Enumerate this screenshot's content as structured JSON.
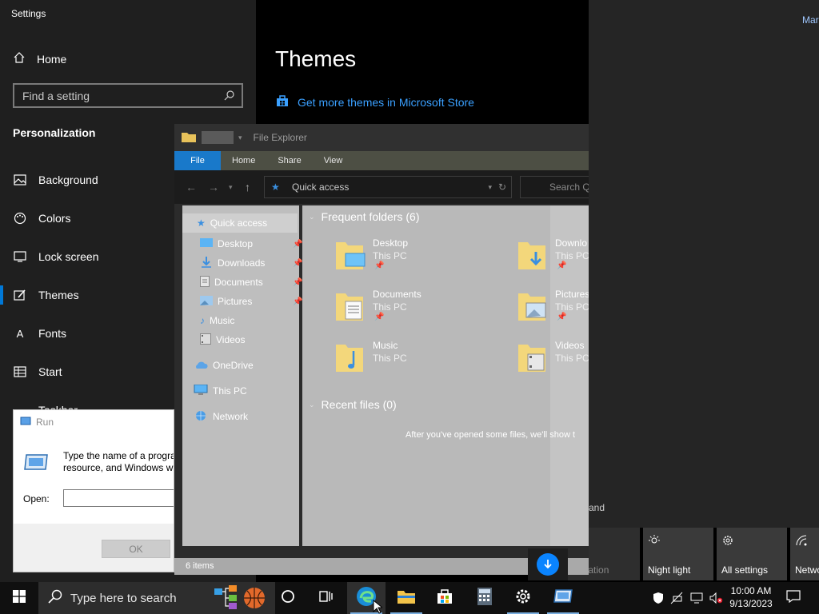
{
  "settings": {
    "window_title": "Settings",
    "home_label": "Home",
    "search_placeholder": "Find a setting",
    "section_title": "Personalization",
    "nav_items": [
      {
        "label": "Background"
      },
      {
        "label": "Colors"
      },
      {
        "label": "Lock screen"
      },
      {
        "label": "Themes"
      },
      {
        "label": "Fonts"
      },
      {
        "label": "Start"
      },
      {
        "label": "Taskbar"
      }
    ],
    "active_item": "Themes",
    "page_title": "Themes",
    "store_link": "Get more themes in Microsoft Store"
  },
  "user_label": "Mar",
  "run": {
    "title": "Run",
    "description_line1": "Type the name of a progra",
    "description_line2": "resource, and Windows wi",
    "open_label": "Open:",
    "open_value": "",
    "ok_label": "OK"
  },
  "explorer": {
    "title": "File Explorer",
    "ribbon_tabs": [
      "File",
      "Home",
      "Share",
      "View"
    ],
    "address": "Quick access",
    "search_placeholder": "Search Q",
    "nav": {
      "quick_access": "Quick access",
      "items": [
        "Desktop",
        "Downloads",
        "Documents",
        "Pictures",
        "Music",
        "Videos"
      ],
      "onedrive": "OneDrive",
      "this_pc": "This PC",
      "network": "Network"
    },
    "frequent_header": "Frequent folders (6)",
    "folders": [
      {
        "name": "Desktop",
        "location": "This PC"
      },
      {
        "name": "Downlo",
        "location": "This PC"
      },
      {
        "name": "Documents",
        "location": "This PC"
      },
      {
        "name": "Pictures",
        "location": "This PC"
      },
      {
        "name": "Music",
        "location": "This PC"
      },
      {
        "name": "Videos",
        "location": "This PC"
      }
    ],
    "recent_header": "Recent files (0)",
    "recent_empty": "After you've opened some files, we'll show t",
    "status": "6 items"
  },
  "action_center": {
    "bg_text_and": "and",
    "tiles": [
      "Location",
      "Night light",
      "All settings",
      "Netwo"
    ]
  },
  "taskbar": {
    "search_placeholder": "Type here to search",
    "time": "10:00 AM",
    "date": "9/13/2023"
  },
  "colors": {
    "accent": "#0078d7",
    "link": "#3aa0ff",
    "download": "#0a84ff"
  }
}
